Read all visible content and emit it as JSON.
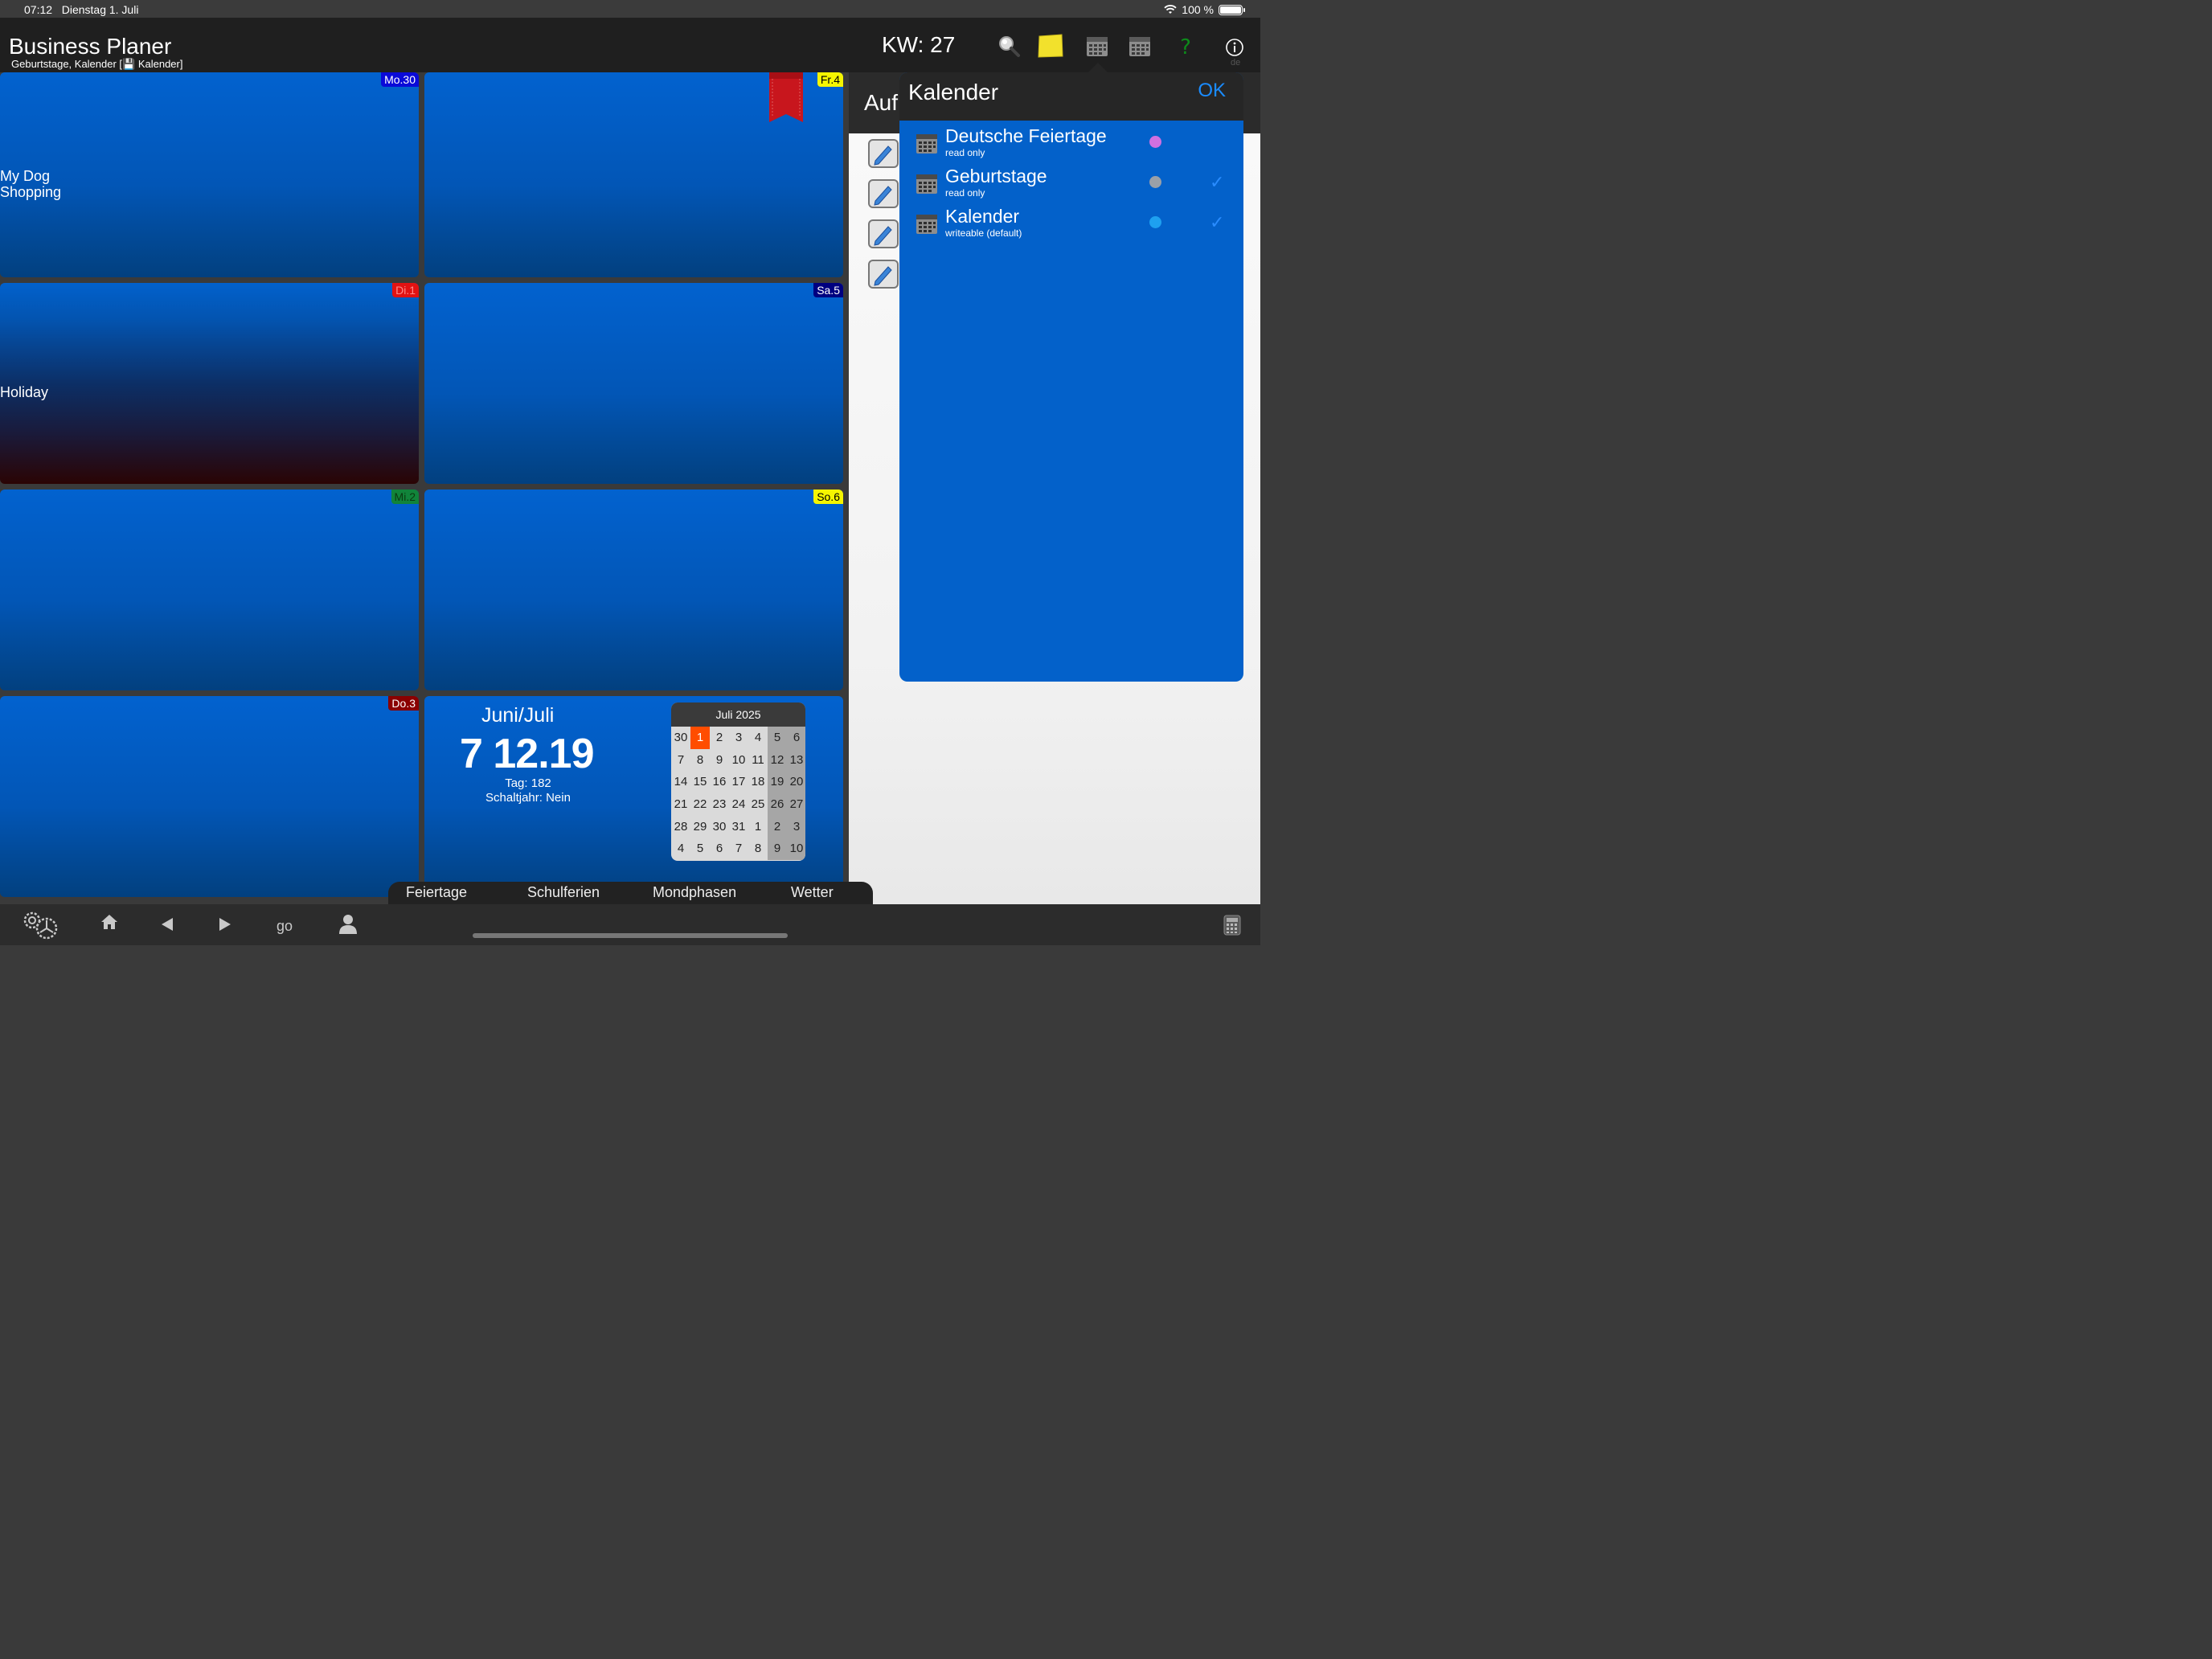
{
  "status_bar": {
    "time": "07:12",
    "date": "Dienstag 1. Juli",
    "battery": "100 %"
  },
  "header": {
    "title": "Business Planer",
    "subtitle": "Geburtstage, Kalender [💾 Kalender]",
    "week": "KW: 27",
    "lang": "de"
  },
  "week": {
    "days": [
      {
        "tag": "Mo.30",
        "tag_bg": "#0a0ad8",
        "tag_fg": "#ffffff",
        "events": [
          "My Dog",
          "Shopping"
        ]
      },
      {
        "tag": "Fr.4",
        "tag_bg": "#f5f500",
        "tag_fg": "#000000",
        "events": []
      },
      {
        "tag": "Di.1",
        "tag_bg": "#e21212",
        "tag_fg": "#ff8080",
        "events": [
          "Holiday"
        ]
      },
      {
        "tag": "Sa.5",
        "tag_bg": "#000080",
        "tag_fg": "#ffffff",
        "events": []
      },
      {
        "tag": "Mi.2",
        "tag_bg": "#11843a",
        "tag_fg": "#0b3a10",
        "events": []
      },
      {
        "tag": "So.6",
        "tag_bg": "#f5f500",
        "tag_fg": "#000000",
        "events": []
      },
      {
        "tag": "Do.3",
        "tag_bg": "#8a0000",
        "tag_fg": "#ffffff",
        "events": []
      }
    ]
  },
  "info": {
    "month": "Juni/Juli",
    "big_date": "7 12.19",
    "day_of_year": "Tag: 182",
    "leap_year": "Schaltjahr: Nein"
  },
  "mini_calendar": {
    "title": "Juli 2025",
    "rows": [
      [
        "30",
        "1",
        "2",
        "3",
        "4",
        "5",
        "6"
      ],
      [
        "7",
        "8",
        "9",
        "10",
        "11",
        "12",
        "13"
      ],
      [
        "14",
        "15",
        "16",
        "17",
        "18",
        "19",
        "20"
      ],
      [
        "21",
        "22",
        "23",
        "24",
        "25",
        "26",
        "27"
      ],
      [
        "28",
        "29",
        "30",
        "31",
        "1",
        "2",
        "3"
      ],
      [
        "4",
        "5",
        "6",
        "7",
        "8",
        "9",
        "10"
      ]
    ],
    "today": "1"
  },
  "todo": {
    "title": "Auf"
  },
  "calendar_popup": {
    "title": "Kalender",
    "ok": "OK",
    "calendars": [
      {
        "name": "Deutsche Feiertage",
        "access": "read only",
        "color": "#d070e0",
        "checked": false
      },
      {
        "name": "Geburtstage",
        "access": "read only",
        "color": "#9aa0a8",
        "checked": true
      },
      {
        "name": "Kalender",
        "access": "writeable (default)",
        "color": "#1ea0f0",
        "checked": true
      }
    ]
  },
  "bottom_tabs": [
    "Feiertage",
    "Schulferien",
    "Mondphasen",
    "Wetter"
  ],
  "toolbar": {
    "go": "go"
  }
}
